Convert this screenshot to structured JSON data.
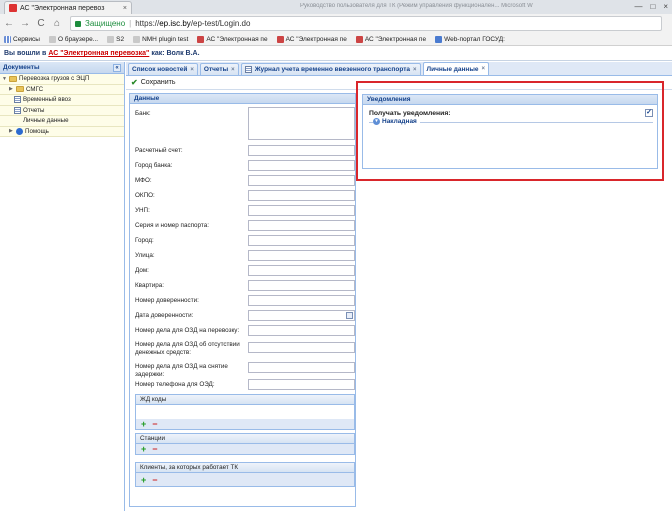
{
  "browser": {
    "tab_title": "АС \"Электронная перевоз",
    "tab_close": "×",
    "ghost_text": "Руководство пользователя для ТК (Режим управления функционален...   Microsoft W",
    "window_controls": [
      "—",
      "□",
      "×"
    ],
    "nav": {
      "back": "←",
      "forward": "→",
      "reload": "C",
      "home": "⌂"
    },
    "secure_label": "Защищено",
    "url_scheme": "https://",
    "url_host": "ep.isc.by",
    "url_path": "/ep-test/Login.do"
  },
  "bookmarks": [
    {
      "label": "Сервисы",
      "icon": "grid-icon"
    },
    {
      "label": "О браузере...",
      "icon": "doc-icon"
    },
    {
      "label": "S2",
      "icon": "doc-icon"
    },
    {
      "label": "NMH plugin test",
      "icon": "doc-icon"
    },
    {
      "label": "АС \"Электронная пе",
      "icon": "red-icon"
    },
    {
      "label": "АС \"Электронная пе",
      "icon": "red-icon"
    },
    {
      "label": "АС \"Электронная пе",
      "icon": "red-icon"
    },
    {
      "label": "Web-портал ГОСУД:",
      "icon": "blue-icon"
    }
  ],
  "header": {
    "prefix": "Вы вошли в",
    "system_link": "АС \"Электронная перевозка\"",
    "suffix": "как: Волк В.А."
  },
  "sidebar": {
    "title": "Документы",
    "collapse": "«",
    "items": [
      {
        "label": "Перевозка грузов с ЭЦП",
        "expander": "▼"
      },
      {
        "label": "СМГС",
        "expander": "▶"
      },
      {
        "label": "Временный ввоз",
        "expander": ""
      },
      {
        "label": "Отчеты",
        "expander": ""
      },
      {
        "label": "Личные данные",
        "expander": ""
      },
      {
        "label": "Помощь",
        "expander": "▶"
      }
    ]
  },
  "tabs": [
    {
      "label": "Список новостей",
      "close": "×"
    },
    {
      "label": "Отчеты",
      "close": "×"
    },
    {
      "label": "Журнал учета временно ввезенного транспорта",
      "close": "×"
    },
    {
      "label": "Личные данные",
      "close": "×"
    }
  ],
  "toolbar": {
    "save_label": "Сохранить",
    "save_icon": "✔"
  },
  "form": {
    "title": "Данные",
    "fields": [
      "Банк:",
      "Расчетный счет:",
      "Город банка:",
      "МФО:",
      "ОКПО:",
      "УНП:",
      "Серия и номер паспорта:",
      "Город:",
      "Улица:",
      "Дом:",
      "Квартира:",
      "Номер доверенности:",
      "Дата доверенности:",
      "Номер дела для ОЗД на перевозку:",
      "Номер дела для ОЗД об отсутствии денежных средств:",
      "Номер дела для ОЗД на снятие задержки:",
      "Номер телефона для ОЭД:"
    ],
    "grids": [
      {
        "title": "ЖД коды"
      },
      {
        "title": "Станции"
      },
      {
        "title": "Клиенты, за которых работает ТК"
      }
    ],
    "add_symbol": "+",
    "remove_symbol": "−"
  },
  "notifications": {
    "title": "Уведомления",
    "receive_label": "Получать уведомления:",
    "receive_checked": "✓",
    "group_toggle": "▾",
    "group_label": "Накладная"
  }
}
